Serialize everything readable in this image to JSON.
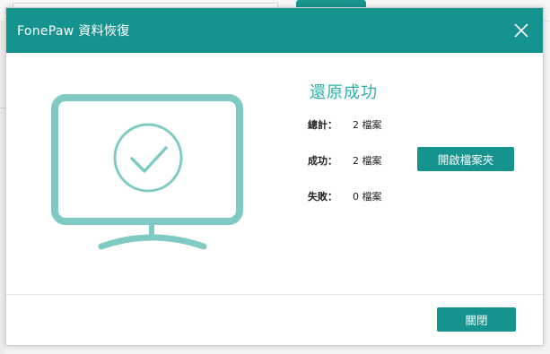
{
  "dialog": {
    "title": "FonePaw 資料恢復"
  },
  "result": {
    "heading": "還原成功",
    "total_label": "總計：",
    "total_value": "2 檔案",
    "success_label": "成功：",
    "success_value": "2 檔案",
    "failed_label": "失敗：",
    "failed_value": "0 檔案"
  },
  "buttons": {
    "open_folder": "開啟檔案夾",
    "close": "關閉"
  },
  "colors": {
    "accent": "#16938f",
    "heading": "#2eb1a7",
    "illustration": "#7fcbc4"
  },
  "icons": {
    "close": "close-icon",
    "illustration": "monitor-check-icon"
  }
}
